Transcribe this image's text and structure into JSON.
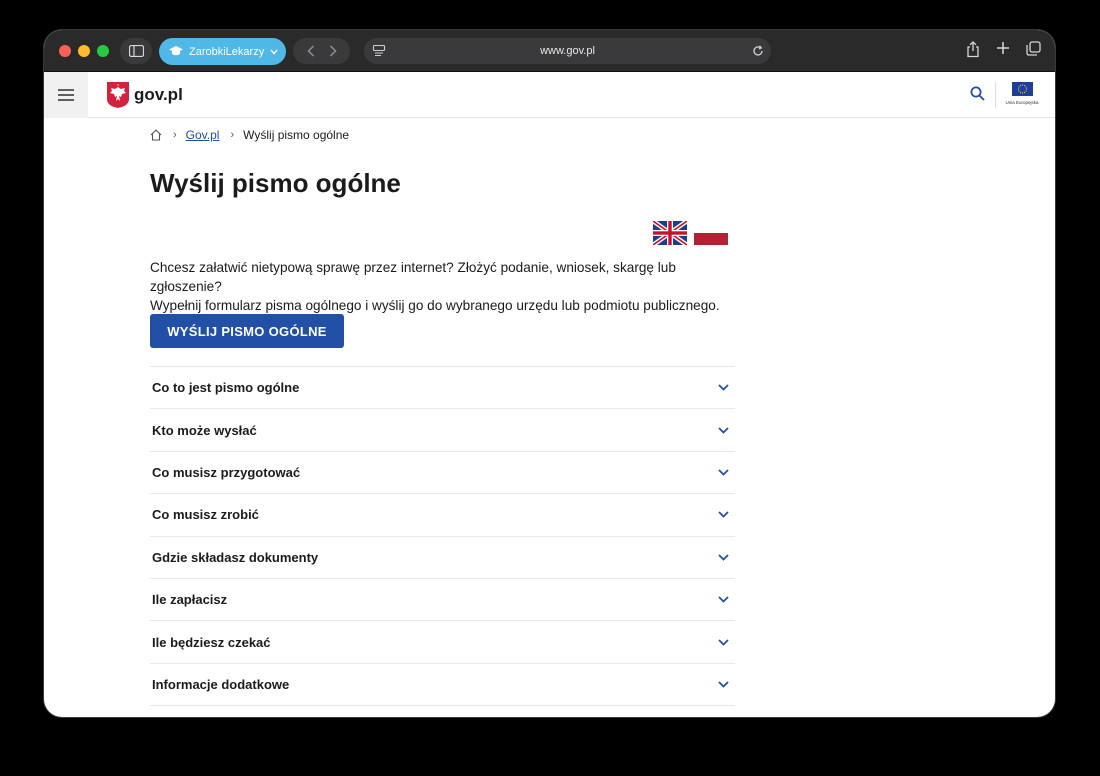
{
  "browser": {
    "profile_label": "ZarobkiLekarzy",
    "url": "www.gov.pl"
  },
  "site": {
    "logo_text": "gov.pl",
    "eu_label": "Unia Europejska"
  },
  "breadcrumb": {
    "home_link": "Gov.pl",
    "current": "Wyślij pismo ogólne"
  },
  "page": {
    "title": "Wyślij pismo ogólne",
    "intro_line1": "Chcesz załatwić nietypową sprawę przez internet? Złożyć podanie, wniosek, skargę lub zgłoszenie?",
    "intro_line2": "Wypełnij formularz pisma ogólnego i wyślij go do wybranego urzędu lub podmiotu publicznego.",
    "cta_label": "WYŚLIJ PISMO OGÓLNE"
  },
  "accordion": [
    {
      "label": "Co to jest pismo ogólne"
    },
    {
      "label": "Kto może wysłać"
    },
    {
      "label": "Co musisz przygotować"
    },
    {
      "label": "Co musisz zrobić"
    },
    {
      "label": "Gdzie składasz dokumenty"
    },
    {
      "label": "Ile zapłacisz"
    },
    {
      "label": "Ile będziesz czekać"
    },
    {
      "label": "Informacje dodatkowe"
    }
  ],
  "icons": {
    "home": "home-icon",
    "chevron": "chevron-down-icon",
    "search": "search-icon",
    "menu": "hamburger-icon"
  },
  "colors": {
    "accent": "#2150a6",
    "link": "#1f4f9e",
    "profile": "#4fb8e6"
  }
}
